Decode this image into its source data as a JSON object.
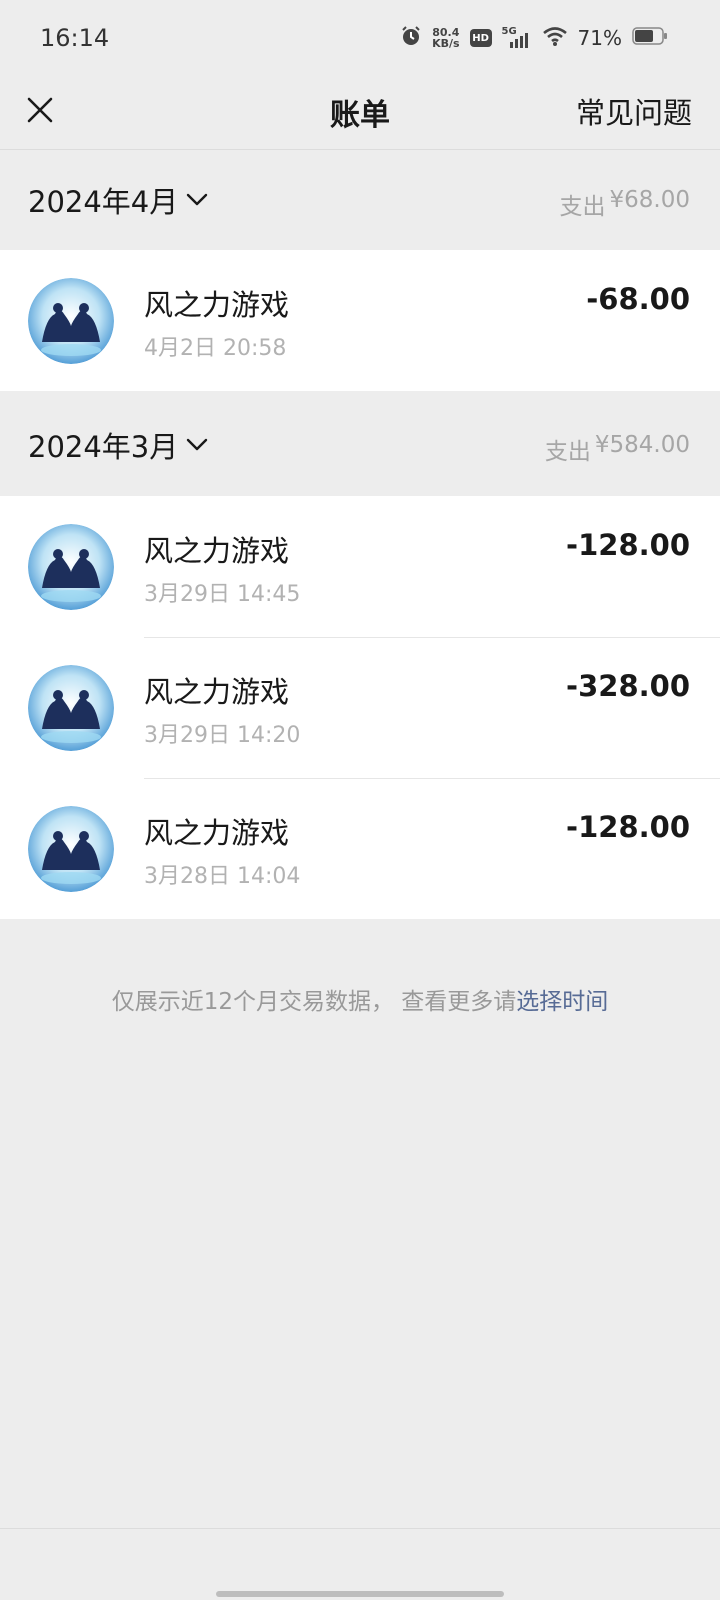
{
  "status_bar": {
    "time": "16:14",
    "net_speed_value": "80.4",
    "net_speed_unit": "KB/s",
    "hd_label": "HD",
    "network_label": "5G",
    "battery_percent": "71%",
    "battery_level": 0.71
  },
  "header": {
    "title": "账单",
    "faq_label": "常见问题"
  },
  "months": [
    {
      "label": "2024年4月",
      "expense_label": "支出",
      "expense_amount": "¥68.00",
      "transactions": [
        {
          "name": "风之力游戏",
          "time": "4月2日 20:58",
          "amount": "-68.00"
        }
      ]
    },
    {
      "label": "2024年3月",
      "expense_label": "支出",
      "expense_amount": "¥584.00",
      "transactions": [
        {
          "name": "风之力游戏",
          "time": "3月29日 14:45",
          "amount": "-128.00"
        },
        {
          "name": "风之力游戏",
          "time": "3月29日 14:20",
          "amount": "-328.00"
        },
        {
          "name": "风之力游戏",
          "time": "3月28日 14:04",
          "amount": "-128.00"
        }
      ]
    }
  ],
  "footer": {
    "note_text": "仅展示近12个月交易数据， 查看更多请",
    "link_text": "选择时间"
  },
  "colors": {
    "background": "#ededed",
    "card": "#ffffff",
    "link": "#576b95",
    "secondary_text": "#b2b2b2"
  },
  "icons": [
    "close-icon",
    "chevron-down-icon",
    "alarm-icon",
    "signal-icon",
    "wifi-icon",
    "battery-icon",
    "game-avatar-icon"
  ]
}
